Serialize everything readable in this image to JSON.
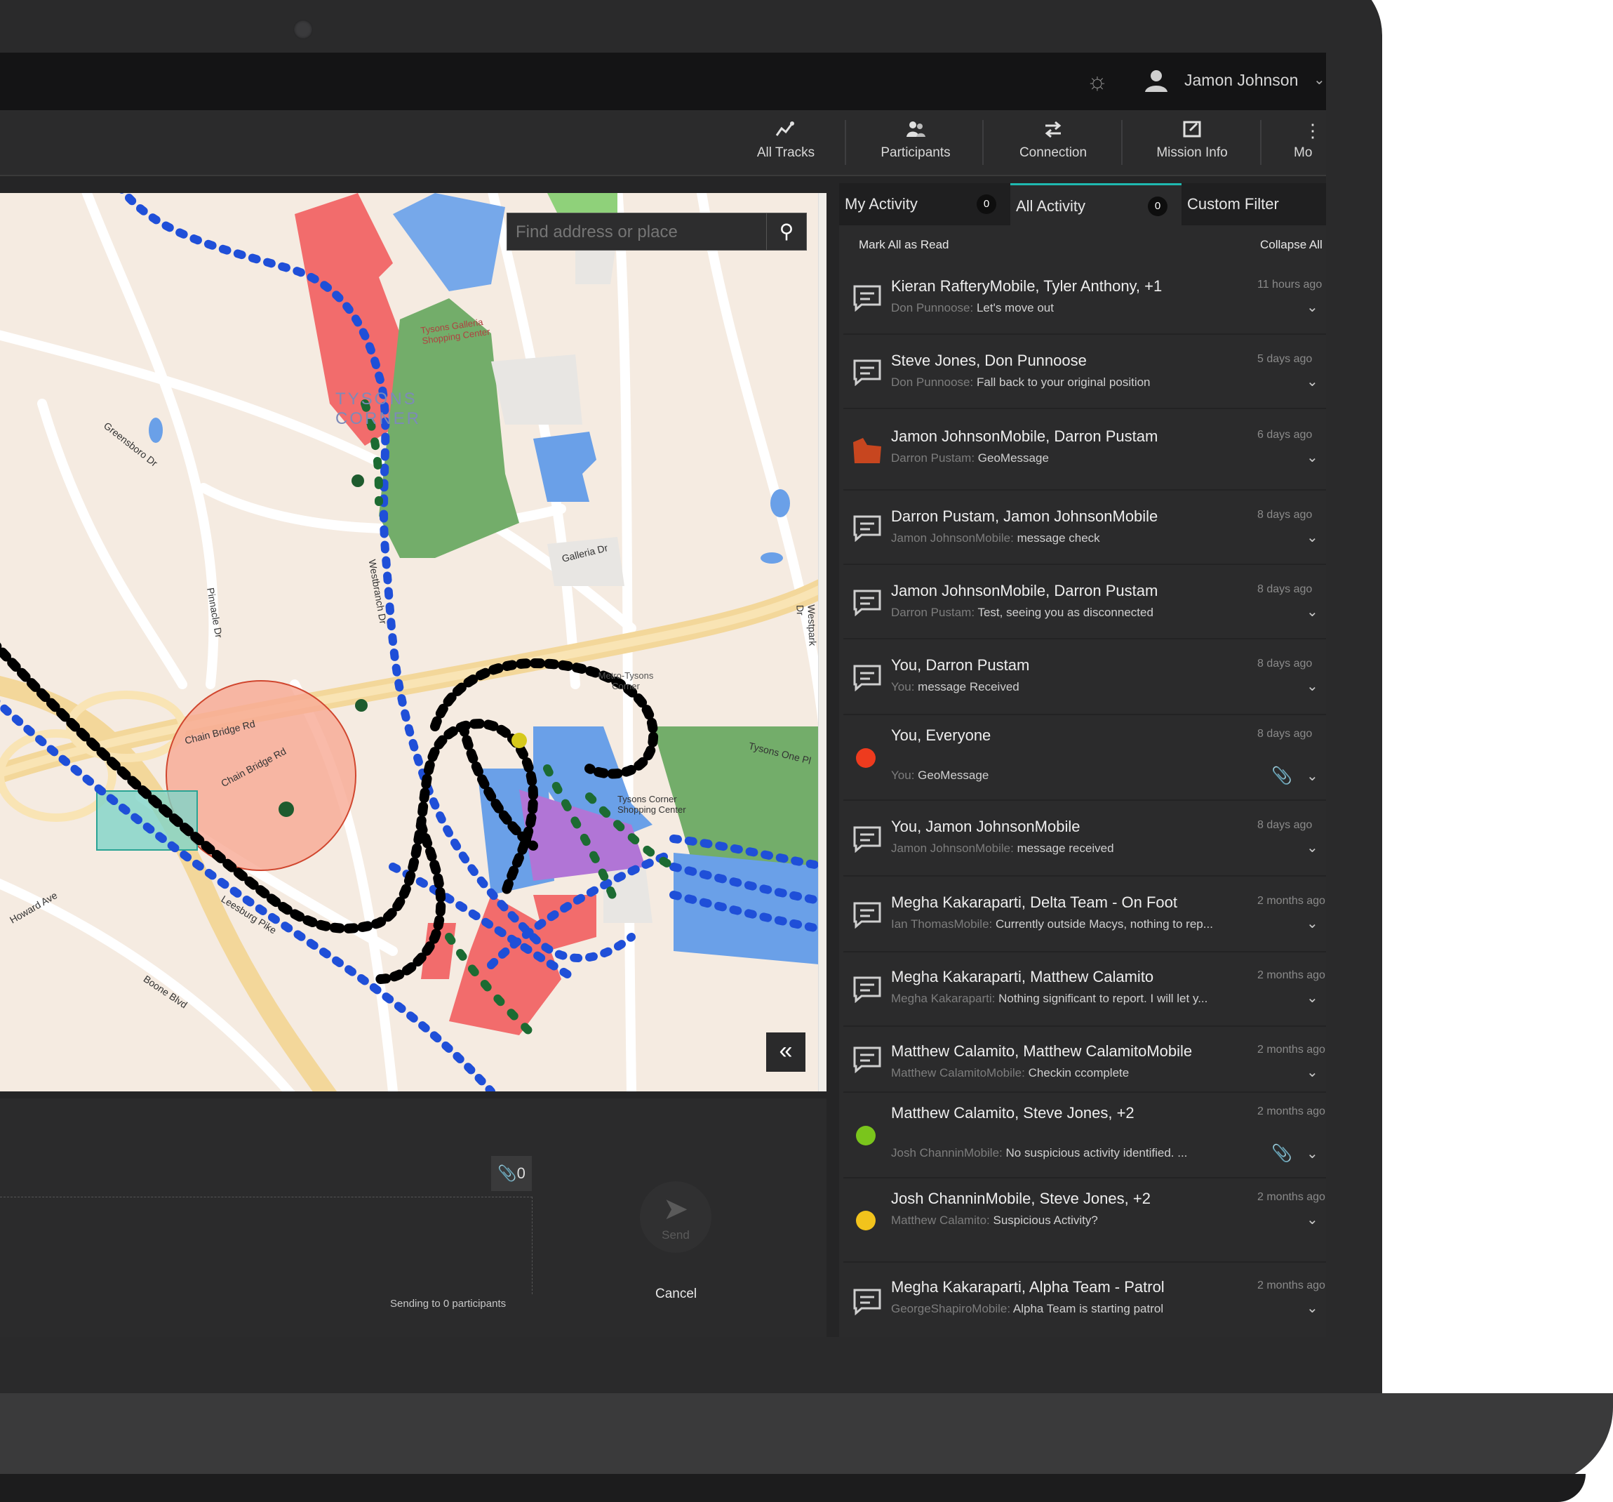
{
  "user": {
    "name": "Jamon Johnson"
  },
  "toolbar": [
    {
      "label": "All Tracks",
      "icon": "tracks-icon"
    },
    {
      "label": "Participants",
      "icon": "participants-icon"
    },
    {
      "label": "Connection",
      "icon": "connection-icon"
    },
    {
      "label": "Mission Info",
      "icon": "mission-info-icon"
    },
    {
      "label": "Mo",
      "icon": "more-icon"
    }
  ],
  "map": {
    "search_placeholder": "Find address or place",
    "labels": {
      "tysons_corner": "TYSONS CORNER",
      "galleria": "Tysons Galleria Shopping Center",
      "metro": "Metro-Tysons Corner",
      "tysons_corner_center": "Tysons Corner Shopping Center",
      "chain_bridge_1": "Chain Bridge Rd",
      "chain_bridge_2": "Chain Bridge Rd",
      "galleria_dr": "Galleria Dr",
      "leesburg": "Leesburg Pike",
      "tysons_one": "Tysons One Pl",
      "boone": "Boone Blvd",
      "howard": "Howard Ave",
      "greensboro": "Greensboro Dr",
      "pinnacle": "Pinnacle Dr",
      "westpark": "Westpark Dr",
      "westbranch": "Westbranch Dr"
    }
  },
  "compose": {
    "attach_count": "0",
    "sending": "Sending to 0 participants",
    "send": "Send",
    "cancel": "Cancel"
  },
  "activity": {
    "tabs": [
      {
        "label": "My Activity",
        "count": "0"
      },
      {
        "label": "All Activity",
        "count": "0"
      },
      {
        "label": "Custom Filter"
      }
    ],
    "mark_all": "Mark All as Read",
    "collapse_all": "Collapse All",
    "items": [
      {
        "type": "chat",
        "title": "Kieran RafteryMobile, Tyler Anthony, +1",
        "from": "Don Punnoose:",
        "msg": "Let's move out",
        "time": "11 hours ago"
      },
      {
        "type": "chat",
        "title": "Steve Jones, Don Punnoose",
        "from": "Don Punnoose:",
        "msg": "Fall back to your original position",
        "time": "5 days ago"
      },
      {
        "type": "geo",
        "title": "Jamon JohnsonMobile, Darron Pustam",
        "from": "Darron Pustam:",
        "msg": "GeoMessage",
        "time": "6 days ago"
      },
      {
        "type": "chat",
        "title": "Darron Pustam, Jamon JohnsonMobile",
        "from": "Jamon JohnsonMobile:",
        "msg": "message check",
        "time": "8 days ago"
      },
      {
        "type": "chat",
        "title": "Jamon JohnsonMobile, Darron Pustam",
        "from": "Darron Pustam:",
        "msg": "Test, seeing you as disconnected",
        "time": "8 days ago"
      },
      {
        "type": "chat",
        "title": "You, Darron Pustam",
        "from": "You:",
        "msg": "message Received",
        "time": "8 days ago"
      },
      {
        "type": "dot",
        "color": "#ee3b1e",
        "title": "You, Everyone",
        "from": "You:",
        "msg": "GeoMessage",
        "time": "8 days ago",
        "clip": true
      },
      {
        "type": "chat",
        "title": "You, Jamon JohnsonMobile",
        "from": "Jamon JohnsonMobile:",
        "msg": "message received",
        "time": "8 days ago"
      },
      {
        "type": "chat",
        "title": "Megha Kakaraparti, Delta Team - On Foot",
        "from": "Ian ThomasMobile:",
        "msg": "Currently outside Macys, nothing to rep...",
        "time": "2 months ago"
      },
      {
        "type": "chat",
        "title": "Megha Kakaraparti, Matthew Calamito",
        "from": "Megha Kakaraparti:",
        "msg": "Nothing significant to report. I will let y...",
        "time": "2 months ago"
      },
      {
        "type": "chat",
        "title": "Matthew Calamito, Matthew CalamitoMobile",
        "from": "Matthew CalamitoMobile:",
        "msg": "Checkin ccomplete",
        "time": "2 months ago"
      },
      {
        "type": "dot",
        "color": "#7ac51c",
        "title": "Matthew Calamito, Steve Jones, +2",
        "from": "Josh ChanninMobile:",
        "msg": "No suspicious activity identified. ...",
        "time": "2 months ago",
        "clip": true
      },
      {
        "type": "dot",
        "color": "#f2c31c",
        "title": "Josh ChanninMobile, Steve Jones, +2",
        "from": "Matthew Calamito:",
        "msg": "Suspicious Activity?",
        "time": "2 months ago"
      },
      {
        "type": "chat",
        "title": "Megha Kakaraparti, Alpha Team - Patrol",
        "from": "GeorgeShapiroMobile:",
        "msg": "Alpha Team is starting patrol",
        "time": "2 months ago"
      }
    ]
  }
}
